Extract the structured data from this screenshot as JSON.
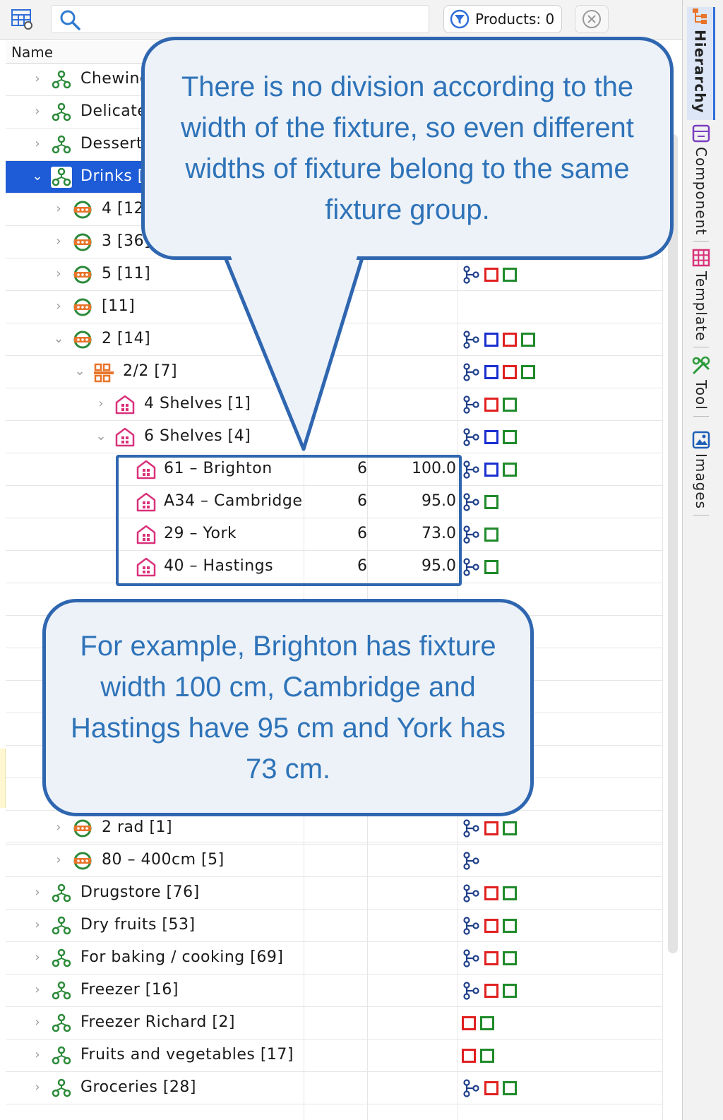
{
  "toolbar": {
    "search_value": "",
    "products_label": "Products: 0"
  },
  "column_header": "Name",
  "colors": {
    "selection": "#1e5bd6",
    "callout_border": "#2f66b0",
    "callout_text": "#2e73b8",
    "callout_fill": "#edf2f9",
    "red": "#e02020",
    "green": "#1f8a2a",
    "blue": "#1a2fd0"
  },
  "tree": {
    "rows": [
      {
        "label": "Chewing",
        "c1": "",
        "c2": "",
        "badges": ""
      },
      {
        "label": "Delicate",
        "c1": "",
        "c2": "",
        "badges": ""
      },
      {
        "label": "Dessert",
        "c1": "",
        "c2": "",
        "badges": ""
      },
      {
        "label": "Drinks [",
        "c1": "",
        "c2": "",
        "badges": ""
      },
      {
        "label": "4 [12",
        "c1": "",
        "c2": "",
        "badges": ""
      },
      {
        "label": "3 [36]",
        "c1": "",
        "c2": "",
        "badges": ""
      },
      {
        "label": "5 [11]",
        "c1": "",
        "c2": "",
        "badges": "hrg"
      },
      {
        "label": " [11]",
        "c1": "",
        "c2": "",
        "badges": ""
      },
      {
        "label": "2 [14]",
        "c1": "",
        "c2": "",
        "badges": "hbrg"
      },
      {
        "label": "2/2 [7]",
        "c1": "",
        "c2": "",
        "badges": "hbrg"
      },
      {
        "label": "4 Shelves [1]",
        "c1": "",
        "c2": "",
        "badges": "hrg"
      },
      {
        "label": "6 Shelves [4]",
        "c1": "",
        "c2": "",
        "badges": "hbg"
      },
      {
        "label": "61 – Brighton",
        "c1": "6",
        "c2": "100.0",
        "badges": "hbg"
      },
      {
        "label": "A34 – Cambridge",
        "c1": "6",
        "c2": "95.0",
        "badges": "hg"
      },
      {
        "label": "29 – York",
        "c1": "6",
        "c2": "73.0",
        "badges": "hg"
      },
      {
        "label": "40 – Hastings",
        "c1": "6",
        "c2": "95.0",
        "badges": "hg"
      },
      {
        "label": "",
        "c1": "",
        "c2": "",
        "badges": ""
      },
      {
        "label": "2 rad [1]",
        "c1": "",
        "c2": "",
        "badges": "hrg"
      },
      {
        "label": "80 – 400cm [5]",
        "c1": "",
        "c2": "",
        "badges": "h"
      },
      {
        "label": "Drugstore [76]",
        "c1": "",
        "c2": "",
        "badges": "hrg"
      },
      {
        "label": "Dry fruits [53]",
        "c1": "",
        "c2": "",
        "badges": "hrg"
      },
      {
        "label": "For baking / cooking [69]",
        "c1": "",
        "c2": "",
        "badges": "hrg"
      },
      {
        "label": "Freezer [16]",
        "c1": "",
        "c2": "",
        "badges": "hrg"
      },
      {
        "label": "Freezer Richard [2]",
        "c1": "",
        "c2": "",
        "badges": "rg"
      },
      {
        "label": "Fruits and vegetables [17]",
        "c1": "",
        "c2": "",
        "badges": "rg"
      },
      {
        "label": "Groceries [28]",
        "c1": "",
        "c2": "",
        "badges": "hrg"
      }
    ]
  },
  "callouts": {
    "top": "There is no division according to the width of the fixture, so even different widths of fixture belong to the same fixture group.",
    "bottom": "For example, Brighton has fixture width 100 cm, Cambridge and Hastings have 95 cm and York has 73 cm."
  },
  "side_tabs": [
    "Hierarchy",
    "Component",
    "Template",
    "Tool",
    "Images"
  ]
}
